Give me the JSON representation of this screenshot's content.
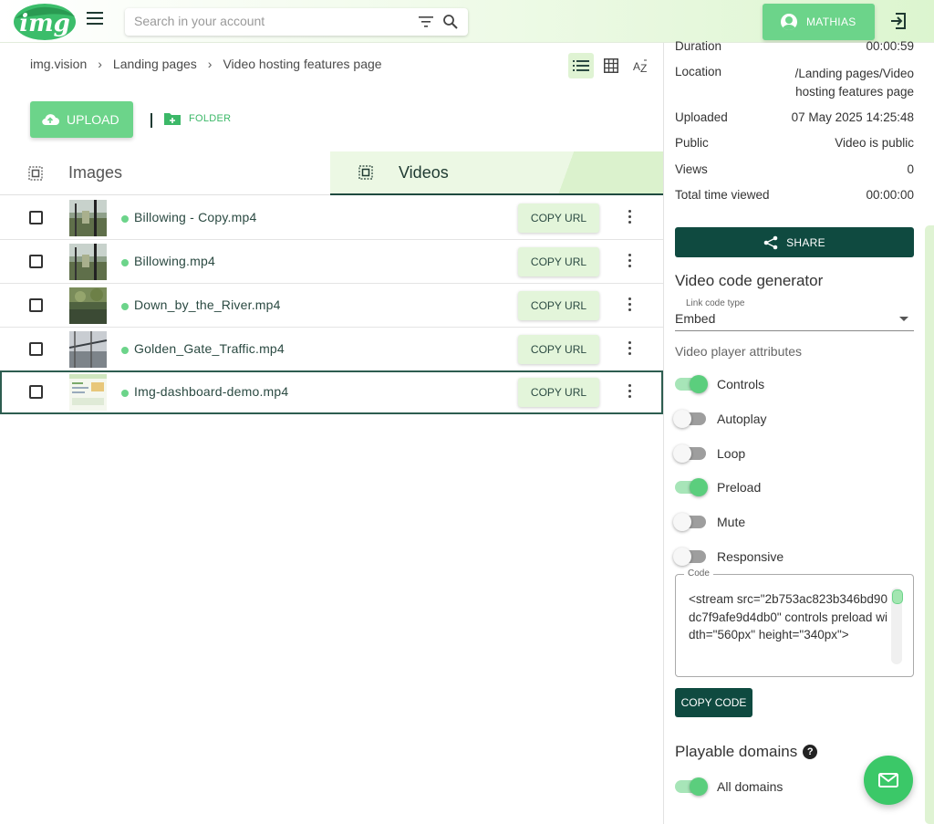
{
  "header": {
    "logo_text": "img",
    "search_placeholder": "Search in your account",
    "user_name": "MATHIAS"
  },
  "breadcrumb": [
    "img.vision",
    "Landing pages",
    "Video hosting features page"
  ],
  "toolbar": {
    "upload_label": "UPLOAD",
    "folder_label": "FOLDER"
  },
  "tabs": [
    {
      "label": "Images",
      "active": false
    },
    {
      "label": "Videos",
      "active": true
    }
  ],
  "files": [
    {
      "name": "Billowing - Copy.mp4",
      "copy_label": "COPY URL",
      "thumb": "bridge"
    },
    {
      "name": "Billowing.mp4",
      "copy_label": "COPY URL",
      "thumb": "bridge"
    },
    {
      "name": "Down_by_the_River.mp4",
      "copy_label": "COPY URL",
      "thumb": "river"
    },
    {
      "name": "Golden_Gate_Traffic.mp4",
      "copy_label": "COPY URL",
      "thumb": "gate"
    },
    {
      "name": "Img-dashboard-demo.mp4",
      "copy_label": "COPY URL",
      "thumb": "dashboard",
      "selected": true
    }
  ],
  "details": [
    {
      "label": "Duration",
      "value": "00:00:59"
    },
    {
      "label": "Location",
      "value": "/Landing pages/Video hosting features page"
    },
    {
      "label": "Uploaded",
      "value": "07 May 2025 14:25:48"
    },
    {
      "label": "Public",
      "value": "Video is public"
    },
    {
      "label": "Views",
      "value": "0"
    },
    {
      "label": "Total time viewed",
      "value": "00:00:00"
    }
  ],
  "share_label": "SHARE",
  "code_generator": {
    "title": "Video code generator",
    "link_type_label": "Link code type",
    "link_type_value": "Embed",
    "attributes_label": "Video player attributes",
    "toggles": [
      {
        "label": "Controls",
        "on": true
      },
      {
        "label": "Autoplay",
        "on": false
      },
      {
        "label": "Loop",
        "on": false
      },
      {
        "label": "Preload",
        "on": true
      },
      {
        "label": "Mute",
        "on": false
      },
      {
        "label": "Responsive",
        "on": false
      }
    ],
    "code_label": "Code",
    "code": "<stream src=\"2b753ac823b346bd90dc7f9afe9d4db0\" controls preload width=\"560px\" height=\"340px\">",
    "copy_code_label": "COPY CODE"
  },
  "playable_domains": {
    "title": "Playable domains",
    "toggle_label": "All domains",
    "on": true
  },
  "colors": {
    "accent": "#6cd48a",
    "dark": "#0f4a40",
    "tab_bg": "#ecf8e4"
  }
}
